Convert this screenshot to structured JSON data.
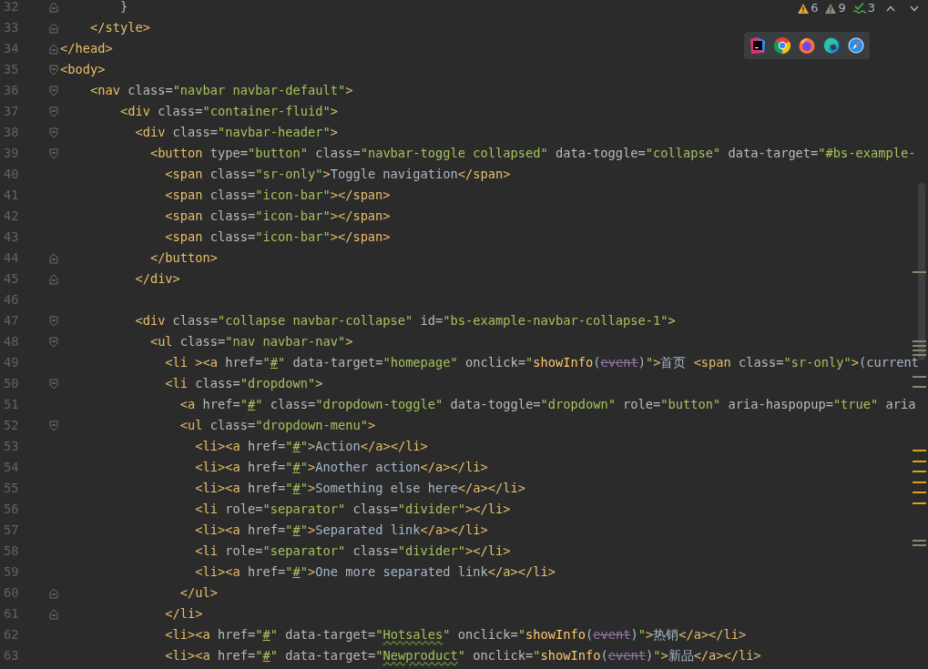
{
  "inspections": [
    {
      "kind": "warning",
      "count": "6"
    },
    {
      "kind": "weak",
      "count": "9"
    },
    {
      "kind": "typo",
      "count": "3"
    }
  ],
  "lines": [
    {
      "number": "32",
      "kind": "foldend",
      "tokens": [
        {
          "kind": "text",
          "text": "        }"
        }
      ]
    },
    {
      "number": "33",
      "kind": "foldend",
      "tokens": [
        {
          "kind": "tag",
          "text": "    </style>"
        }
      ]
    },
    {
      "number": "34",
      "kind": "foldend",
      "tokens": [
        {
          "kind": "tag",
          "text": "</head>"
        }
      ]
    },
    {
      "number": "35",
      "kind": "foldstart",
      "tokens": [
        {
          "kind": "tag",
          "text": "<body>"
        }
      ]
    },
    {
      "number": "36",
      "kind": "foldstart",
      "tokens": [
        {
          "kind": "tag",
          "text": "    <nav"
        },
        {
          "kind": "attr",
          "text": " class="
        },
        {
          "kind": "value",
          "text": "\"navbar navbar-default\""
        },
        {
          "kind": "tag",
          "text": ">"
        }
      ]
    },
    {
      "number": "37",
      "kind": "foldstart",
      "tokens": [
        {
          "kind": "tag",
          "text": "        <div"
        },
        {
          "kind": "attr",
          "text": " class="
        },
        {
          "kind": "value",
          "text": "\"container-fluid\""
        },
        {
          "kind": "tag",
          "text": ">"
        }
      ]
    },
    {
      "number": "38",
      "kind": "foldstart",
      "tokens": [
        {
          "kind": "tag",
          "text": "          <div"
        },
        {
          "kind": "attr",
          "text": " class="
        },
        {
          "kind": "value",
          "text": "\"navbar-header\""
        },
        {
          "kind": "tag",
          "text": ">"
        }
      ]
    },
    {
      "number": "39",
      "kind": "foldstart",
      "tokens": [
        {
          "kind": "tag",
          "text": "            <button"
        },
        {
          "kind": "attr",
          "text": " type="
        },
        {
          "kind": "value",
          "text": "\"button\""
        },
        {
          "kind": "attr",
          "text": " class="
        },
        {
          "kind": "value",
          "text": "\"navbar-toggle collapsed\""
        },
        {
          "kind": "attr",
          "text": " data-toggle="
        },
        {
          "kind": "value",
          "text": "\"collapse\""
        },
        {
          "kind": "attr",
          "text": " data-target="
        },
        {
          "kind": "value",
          "text": "\"#bs-example-"
        }
      ]
    },
    {
      "number": "40",
      "kind": "plain",
      "tokens": [
        {
          "kind": "tag",
          "text": "              <span"
        },
        {
          "kind": "attr",
          "text": " class="
        },
        {
          "kind": "value",
          "text": "\"sr-only\""
        },
        {
          "kind": "tag",
          "text": ">"
        },
        {
          "kind": "text",
          "text": "Toggle navigation"
        },
        {
          "kind": "tag",
          "text": "</span>"
        }
      ]
    },
    {
      "number": "41",
      "kind": "plain",
      "tokens": [
        {
          "kind": "tag",
          "text": "              <span"
        },
        {
          "kind": "attr",
          "text": " class="
        },
        {
          "kind": "value",
          "text": "\"icon-bar\""
        },
        {
          "kind": "tag",
          "text": "></span>"
        }
      ]
    },
    {
      "number": "42",
      "kind": "plain",
      "tokens": [
        {
          "kind": "tag",
          "text": "              <span"
        },
        {
          "kind": "attr",
          "text": " class="
        },
        {
          "kind": "value",
          "text": "\"icon-bar\""
        },
        {
          "kind": "tag",
          "text": "></span>"
        }
      ]
    },
    {
      "number": "43",
      "kind": "plain",
      "tokens": [
        {
          "kind": "tag",
          "text": "              <span"
        },
        {
          "kind": "attr",
          "text": " class="
        },
        {
          "kind": "value",
          "text": "\"icon-bar\""
        },
        {
          "kind": "tag",
          "text": "></span>"
        }
      ]
    },
    {
      "number": "44",
      "kind": "foldend",
      "tokens": [
        {
          "kind": "tag",
          "text": "            </button>"
        }
      ]
    },
    {
      "number": "45",
      "kind": "foldend",
      "tokens": [
        {
          "kind": "tag",
          "text": "          </div>"
        }
      ]
    },
    {
      "number": "46",
      "kind": "plain"
    },
    {
      "number": "47",
      "kind": "foldstart",
      "tokens": [
        {
          "kind": "tag",
          "text": "          <div"
        },
        {
          "kind": "attr",
          "text": " class="
        },
        {
          "kind": "value",
          "text": "\"collapse navbar-collapse\""
        },
        {
          "kind": "attr",
          "text": " id="
        },
        {
          "kind": "value",
          "text": "\"bs-example-navbar-collapse-1\""
        },
        {
          "kind": "tag",
          "text": ">"
        }
      ]
    },
    {
      "number": "48",
      "kind": "foldstart",
      "tokens": [
        {
          "kind": "tag",
          "text": "            <ul"
        },
        {
          "kind": "attr",
          "text": " class="
        },
        {
          "kind": "value",
          "text": "\"nav navbar-nav\""
        },
        {
          "kind": "tag",
          "text": ">"
        }
      ]
    },
    {
      "number": "49",
      "kind": "plain",
      "tokens": [
        {
          "kind": "tag",
          "text": "              <li ><a"
        },
        {
          "kind": "attr",
          "text": " href="
        },
        {
          "kind": "value",
          "text": "\""
        },
        {
          "kind": "ref",
          "text": "#"
        },
        {
          "kind": "value",
          "text": "\""
        },
        {
          "kind": "attr",
          "text": " data-target="
        },
        {
          "kind": "value",
          "text": "\"homepage\""
        },
        {
          "kind": "attr",
          "text": " onclick="
        },
        {
          "kind": "value",
          "text": "\""
        },
        {
          "kind": "fn",
          "text": "showInfo"
        },
        {
          "kind": "text",
          "text": "("
        },
        {
          "kind": "param",
          "text": "event"
        },
        {
          "kind": "text",
          "text": ")"
        },
        {
          "kind": "value",
          "text": "\""
        },
        {
          "kind": "tag",
          "text": ">"
        },
        {
          "kind": "text",
          "text": "首页 "
        },
        {
          "kind": "tag",
          "text": "<span"
        },
        {
          "kind": "attr",
          "text": " class="
        },
        {
          "kind": "value",
          "text": "\"sr-only\""
        },
        {
          "kind": "tag",
          "text": ">"
        },
        {
          "kind": "text",
          "text": "(current"
        }
      ]
    },
    {
      "number": "50",
      "kind": "foldstart",
      "tokens": [
        {
          "kind": "tag",
          "text": "              <li"
        },
        {
          "kind": "attr",
          "text": " class="
        },
        {
          "kind": "value",
          "text": "\"dropdown\""
        },
        {
          "kind": "tag",
          "text": ">"
        }
      ]
    },
    {
      "number": "51",
      "kind": "plain",
      "tokens": [
        {
          "kind": "tag",
          "text": "                <a"
        },
        {
          "kind": "attr",
          "text": " href="
        },
        {
          "kind": "value",
          "text": "\""
        },
        {
          "kind": "ref",
          "text": "#"
        },
        {
          "kind": "value",
          "text": "\""
        },
        {
          "kind": "attr",
          "text": " class="
        },
        {
          "kind": "value",
          "text": "\"dropdown-toggle\""
        },
        {
          "kind": "attr",
          "text": " data-toggle="
        },
        {
          "kind": "value",
          "text": "\"dropdown\""
        },
        {
          "kind": "attr",
          "text": " role="
        },
        {
          "kind": "value",
          "text": "\"button\""
        },
        {
          "kind": "attr",
          "text": " aria-haspopup="
        },
        {
          "kind": "value",
          "text": "\"true\""
        },
        {
          "kind": "attr",
          "text": " aria"
        }
      ]
    },
    {
      "number": "52",
      "kind": "foldstart",
      "tokens": [
        {
          "kind": "tag",
          "text": "                <ul"
        },
        {
          "kind": "attr",
          "text": " class="
        },
        {
          "kind": "value",
          "text": "\"dropdown-menu\""
        },
        {
          "kind": "tag",
          "text": ">"
        }
      ]
    },
    {
      "number": "53",
      "kind": "plain",
      "tokens": [
        {
          "kind": "tag",
          "text": "                  <li><a"
        },
        {
          "kind": "attr",
          "text": " href="
        },
        {
          "kind": "value",
          "text": "\""
        },
        {
          "kind": "ref",
          "text": "#"
        },
        {
          "kind": "value",
          "text": "\""
        },
        {
          "kind": "tag",
          "text": ">"
        },
        {
          "kind": "text",
          "text": "Action"
        },
        {
          "kind": "tag",
          "text": "</a></li>"
        }
      ]
    },
    {
      "number": "54",
      "kind": "plain",
      "tokens": [
        {
          "kind": "tag",
          "text": "                  <li><a"
        },
        {
          "kind": "attr",
          "text": " href="
        },
        {
          "kind": "value",
          "text": "\""
        },
        {
          "kind": "ref",
          "text": "#"
        },
        {
          "kind": "value",
          "text": "\""
        },
        {
          "kind": "tag",
          "text": ">"
        },
        {
          "kind": "text",
          "text": "Another action"
        },
        {
          "kind": "tag",
          "text": "</a></li>"
        }
      ]
    },
    {
      "number": "55",
      "kind": "plain",
      "tokens": [
        {
          "kind": "tag",
          "text": "                  <li><a"
        },
        {
          "kind": "attr",
          "text": " href="
        },
        {
          "kind": "value",
          "text": "\""
        },
        {
          "kind": "ref",
          "text": "#"
        },
        {
          "kind": "value",
          "text": "\""
        },
        {
          "kind": "tag",
          "text": ">"
        },
        {
          "kind": "text",
          "text": "Something else here"
        },
        {
          "kind": "tag",
          "text": "</a></li>"
        }
      ]
    },
    {
      "number": "56",
      "kind": "plain",
      "tokens": [
        {
          "kind": "tag",
          "text": "                  <li"
        },
        {
          "kind": "attr",
          "text": " role="
        },
        {
          "kind": "value",
          "text": "\"separator\""
        },
        {
          "kind": "attr",
          "text": " class="
        },
        {
          "kind": "value",
          "text": "\"divider\""
        },
        {
          "kind": "tag",
          "text": "></li>"
        }
      ]
    },
    {
      "number": "57",
      "kind": "plain",
      "tokens": [
        {
          "kind": "tag",
          "text": "                  <li><a"
        },
        {
          "kind": "attr",
          "text": " href="
        },
        {
          "kind": "value",
          "text": "\""
        },
        {
          "kind": "ref",
          "text": "#"
        },
        {
          "kind": "value",
          "text": "\""
        },
        {
          "kind": "tag",
          "text": ">"
        },
        {
          "kind": "text",
          "text": "Separated link"
        },
        {
          "kind": "tag",
          "text": "</a></li>"
        }
      ]
    },
    {
      "number": "58",
      "kind": "plain",
      "tokens": [
        {
          "kind": "tag",
          "text": "                  <li"
        },
        {
          "kind": "attr",
          "text": " role="
        },
        {
          "kind": "value",
          "text": "\"separator\""
        },
        {
          "kind": "attr",
          "text": " class="
        },
        {
          "kind": "value",
          "text": "\"divider\""
        },
        {
          "kind": "tag",
          "text": "></li>"
        }
      ]
    },
    {
      "number": "59",
      "kind": "plain",
      "tokens": [
        {
          "kind": "tag",
          "text": "                  <li><a"
        },
        {
          "kind": "attr",
          "text": " href="
        },
        {
          "kind": "value",
          "text": "\""
        },
        {
          "kind": "ref",
          "text": "#"
        },
        {
          "kind": "value",
          "text": "\""
        },
        {
          "kind": "tag",
          "text": ">"
        },
        {
          "kind": "text",
          "text": "One more separated link"
        },
        {
          "kind": "tag",
          "text": "</a></li>"
        }
      ]
    },
    {
      "number": "60",
      "kind": "foldend",
      "tokens": [
        {
          "kind": "tag",
          "text": "                </ul>"
        }
      ]
    },
    {
      "number": "61",
      "kind": "foldend",
      "tokens": [
        {
          "kind": "tag",
          "text": "              </li>"
        }
      ]
    },
    {
      "number": "62",
      "kind": "plain",
      "tokens": [
        {
          "kind": "tag",
          "text": "              <li><a"
        },
        {
          "kind": "attr",
          "text": " href="
        },
        {
          "kind": "value",
          "text": "\""
        },
        {
          "kind": "ref",
          "text": "#"
        },
        {
          "kind": "value",
          "text": "\""
        },
        {
          "kind": "attr",
          "text": " data-target="
        },
        {
          "kind": "value",
          "text": "\""
        },
        {
          "kind": "typo",
          "text": "Hotsales"
        },
        {
          "kind": "value",
          "text": "\""
        },
        {
          "kind": "attr",
          "text": " onclick="
        },
        {
          "kind": "value",
          "text": "\""
        },
        {
          "kind": "fn",
          "text": "showInfo"
        },
        {
          "kind": "text",
          "text": "("
        },
        {
          "kind": "param",
          "text": "event"
        },
        {
          "kind": "text",
          "text": ")"
        },
        {
          "kind": "value",
          "text": "\""
        },
        {
          "kind": "tag",
          "text": ">"
        },
        {
          "kind": "text",
          "text": "热销"
        },
        {
          "kind": "tag",
          "text": "</a></li>"
        }
      ]
    },
    {
      "number": "63",
      "kind": "plain",
      "tokens": [
        {
          "kind": "tag",
          "text": "              <li><a"
        },
        {
          "kind": "attr",
          "text": " href="
        },
        {
          "kind": "value",
          "text": "\""
        },
        {
          "kind": "ref",
          "text": "#"
        },
        {
          "kind": "value",
          "text": "\""
        },
        {
          "kind": "attr",
          "text": " data-target="
        },
        {
          "kind": "value",
          "text": "\""
        },
        {
          "kind": "typo",
          "text": "Newproduct"
        },
        {
          "kind": "value",
          "text": "\""
        },
        {
          "kind": "attr",
          "text": " onclick="
        },
        {
          "kind": "value",
          "text": "\""
        },
        {
          "kind": "fn",
          "text": "showInfo"
        },
        {
          "kind": "text",
          "text": "("
        },
        {
          "kind": "param",
          "text": "event"
        },
        {
          "kind": "text",
          "text": ")"
        },
        {
          "kind": "value",
          "text": "\""
        },
        {
          "kind": "tag",
          "text": ">"
        },
        {
          "kind": "text",
          "text": "新品"
        },
        {
          "kind": "tag",
          "text": "</a></li>"
        }
      ]
    }
  ]
}
